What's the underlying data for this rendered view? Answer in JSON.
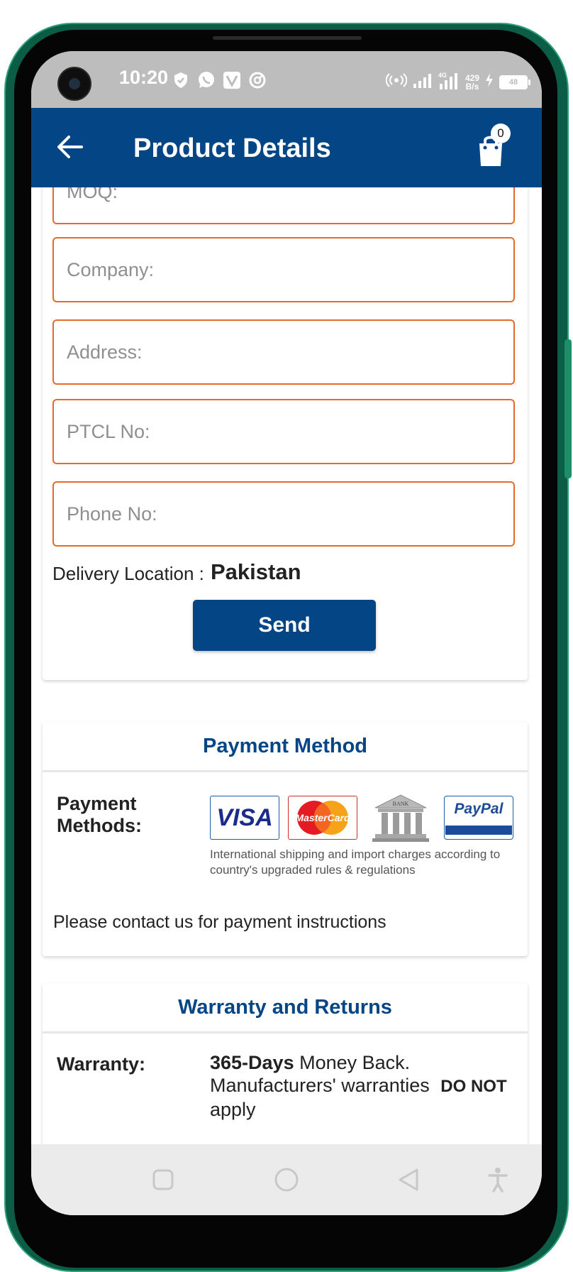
{
  "status_bar": {
    "time": "10:20",
    "network_speed_value": "429",
    "network_speed_unit": "B/s",
    "battery": "48",
    "icons": [
      "shield-icon",
      "whatsapp-icon",
      "vpn-icon",
      "sync-icon",
      "hotspot-icon",
      "signal-icon",
      "lte-signal-icon",
      "charging-icon",
      "battery-icon"
    ]
  },
  "app_bar": {
    "title": "Product Details",
    "cart_count": "0",
    "color": "#044585"
  },
  "form": {
    "moq_placeholder": "MOQ:",
    "company_placeholder": "Company:",
    "address_placeholder": "Address:",
    "ptcl_placeholder": "PTCL No:",
    "phone_placeholder": "Phone No:",
    "delivery_label": "Delivery Location :",
    "delivery_value": "Pakistan",
    "send_label": "Send",
    "field_border_color": "#e56b2a"
  },
  "payment": {
    "header": "Payment Method",
    "label": "Payment Methods:",
    "logos": {
      "visa": "VISA",
      "mastercard": "MasterCard",
      "bank": "BANK",
      "paypal": "PayPal"
    },
    "note": "International shipping and import charges according to country's upgraded rules & regulations",
    "contact": "Please contact us for payment instructions"
  },
  "warranty": {
    "header": "Warranty and Returns",
    "label": "Warranty:",
    "days": "365-Days",
    "text_1": " Money Back. Manufacturers' warranties ",
    "do_not": "DO NOT",
    "text_2": " apply"
  },
  "nav_bar": {
    "icons": [
      "recent-apps-icon",
      "home-icon",
      "back-triangle-icon",
      "accessibility-icon"
    ]
  }
}
